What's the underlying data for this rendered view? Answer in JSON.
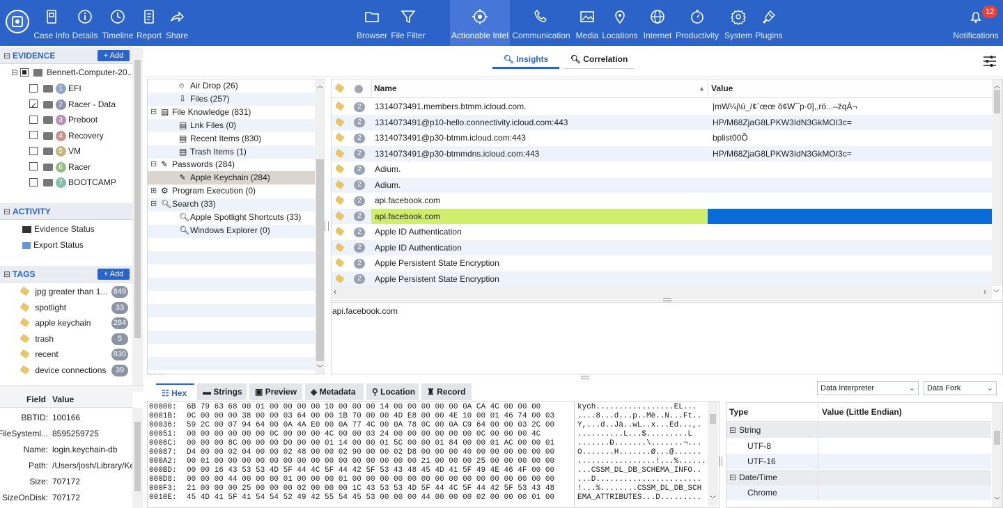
{
  "toolbar": {
    "left": [
      {
        "label": "Case Info",
        "icon": "case-info-icon"
      },
      {
        "label": "Details",
        "icon": "details-icon"
      },
      {
        "label": "Timeline",
        "icon": "timeline-icon"
      },
      {
        "label": "Report",
        "icon": "report-icon"
      },
      {
        "label": "Share",
        "icon": "share-icon"
      }
    ],
    "center": [
      {
        "label": "Browser",
        "icon": "browser-icon"
      },
      {
        "label": "File Filter",
        "icon": "filter-icon"
      },
      {
        "label": "Actionable Intel",
        "icon": "actionable-intel-icon",
        "active": true
      },
      {
        "label": "Communication",
        "icon": "phone-icon"
      },
      {
        "label": "Media",
        "icon": "media-icon"
      },
      {
        "label": "Locations",
        "icon": "location-pin-icon"
      },
      {
        "label": "Internet",
        "icon": "globe-icon"
      },
      {
        "label": "Productivity",
        "icon": "productivity-icon"
      },
      {
        "label": "System",
        "icon": "gear-icon"
      },
      {
        "label": "Plugins",
        "icon": "plugin-icon"
      }
    ],
    "notifications": {
      "label": "Notifications",
      "count": "12"
    }
  },
  "evidence": {
    "title": "EVIDENCE",
    "add_label": "+ Add",
    "root": "Bennett-Computer-20...",
    "items": [
      {
        "num": "1",
        "label": "EFI",
        "checked": false,
        "color": "#8ea5c8"
      },
      {
        "num": "2",
        "label": "Racer - Data",
        "checked": true,
        "color": "#8f8fb8"
      },
      {
        "num": "3",
        "label": "Preboot",
        "checked": false,
        "color": "#b88fb5"
      },
      {
        "num": "4",
        "label": "Recovery",
        "checked": false,
        "color": "#c7958c"
      },
      {
        "num": "5",
        "label": "VM",
        "checked": false,
        "color": "#c2b77f"
      },
      {
        "num": "6",
        "label": "Racer",
        "checked": false,
        "color": "#92bf86"
      },
      {
        "num": "7",
        "label": "BOOTCAMP",
        "checked": false,
        "color": "#86bfa7"
      }
    ]
  },
  "activity": {
    "title": "ACTIVITY",
    "items": [
      "Evidence Status",
      "Export Status"
    ]
  },
  "tags": {
    "title": "TAGS",
    "add_label": "+ Add",
    "items": [
      {
        "label": "jpg greater than 1...",
        "count": "849"
      },
      {
        "label": "spotlight",
        "count": "33"
      },
      {
        "label": "apple keychain",
        "count": "284"
      },
      {
        "label": "trash",
        "count": "5"
      },
      {
        "label": "recent",
        "count": "830"
      },
      {
        "label": "device connections",
        "count": "39"
      }
    ]
  },
  "props": {
    "headers": [
      "Field",
      "Value"
    ],
    "rows": [
      {
        "field": "BBTID:",
        "value": "100166"
      },
      {
        "field": "FileSysteml...",
        "value": "8595259725"
      },
      {
        "field": "Name:",
        "value": "login.keychain-db"
      },
      {
        "field": "Path:",
        "value": "/Users/josh/Library/Key"
      },
      {
        "field": "Size:",
        "value": "707172"
      },
      {
        "field": "SizeOnDisk:",
        "value": "707172"
      }
    ]
  },
  "view_tabs": [
    "Insights",
    "Correlation"
  ],
  "tree": [
    {
      "label": "Air Drop (26)",
      "level": 2,
      "icon": "airdrop-icon"
    },
    {
      "label": "Files (257)",
      "level": 2,
      "icon": "files-icon"
    },
    {
      "label": "File Knowledge (831)",
      "level": 1,
      "icon": "file-knowledge-icon",
      "exp": "−"
    },
    {
      "label": "Lnk Files (0)",
      "level": 2,
      "icon": "document-icon"
    },
    {
      "label": "Recent Items (830)",
      "level": 2,
      "icon": "document-icon"
    },
    {
      "label": "Trash Items (1)",
      "level": 2,
      "icon": "document-icon"
    },
    {
      "label": "Passwords (284)",
      "level": 1,
      "icon": "password-icon",
      "exp": "−"
    },
    {
      "label": "Apple Keychain (284)",
      "level": 2,
      "icon": "password-icon",
      "selected": true
    },
    {
      "label": "Program Execution (0)",
      "level": 1,
      "icon": "program-icon",
      "exp": "+"
    },
    {
      "label": "Search (33)",
      "level": 1,
      "icon": "search-icon",
      "exp": "−"
    },
    {
      "label": "Apple Spotlight Shortcuts (33)",
      "level": 2,
      "icon": "search-icon"
    },
    {
      "label": "Windows Explorer (0)",
      "level": 2,
      "icon": "search-icon"
    }
  ],
  "grid": {
    "headers": [
      "Name",
      "Value"
    ],
    "rows": [
      {
        "ev": "2",
        "name": "1314073491.members.btmm.icloud.com.",
        "value": "|mW¼j\\ú_/¢`œœ õ¢W¯p·0],,rö...–žqÁ¬"
      },
      {
        "ev": "2",
        "name": "1314073491@p10-hello.connectivity.icloud.com:443",
        "value": "HP/M68ZjaG8LPKW3IdN3GkMOI3c="
      },
      {
        "ev": "2",
        "name": "1314073491@p30-btmm.icloud.com:443",
        "value": "bplist00Õ"
      },
      {
        "ev": "2",
        "name": "1314073491@p30-btmmdns.icloud.com:443",
        "value": "HP/M68ZjaG8LPKW3IdN3GkMOI3c="
      },
      {
        "ev": "2",
        "name": "Adium.",
        "value": ""
      },
      {
        "ev": "2",
        "name": "Adium.",
        "value": ""
      },
      {
        "ev": "2",
        "name": "api.facebook.com",
        "value": ""
      },
      {
        "ev": "2",
        "name": "api.facebook.com",
        "value": "",
        "selected": true
      },
      {
        "ev": "2",
        "name": "Apple ID Authentication",
        "value": ""
      },
      {
        "ev": "2",
        "name": "Apple ID Authentication",
        "value": ""
      },
      {
        "ev": "2",
        "name": "Apple Persistent State Encryption",
        "value": ""
      },
      {
        "ev": "2",
        "name": "Apple Persistent State Encryption",
        "value": ""
      }
    ]
  },
  "preview_text": "api.facebook.com",
  "bottom_tabs": [
    "Hex",
    "Strings",
    "Preview",
    "Metadata",
    "Location",
    "Record"
  ],
  "hex": [
    {
      "off": "00000:",
      "bytes": "6B 79 63 68 00 01 00 00 00 00 10 00 00 00 14 00 00 00 00 00 0A CA 4C 00 00 00",
      "ascii": "kych.................ÊL..."
    },
    {
      "off": "0001B:",
      "bytes": "0C 00 00 00 38 00 00 03 64 00 00 1B 70 00 00 4D E8 00 00 4E 10 00 01 46 74 00 03",
      "ascii": "....8...d...p..Mè..N...Ft.."
    },
    {
      "off": "00036:",
      "bytes": "59 2C 00 07 94 64 00 0A 4A E0 00 0A 77 4C 00 0A 78 0C 00 0A C9 64 00 00 03 2C 00",
      "ascii": "Y,...d..Jà..wL..x...Éd...,."
    },
    {
      "off": "00051:",
      "bytes": "00 00 00 00 00 00 0C 00 00 00 4C 00 00 03 24 00 00 00 00 00 00 0C 00 00 00 4C",
      "ascii": "..........L...$.........L"
    },
    {
      "off": "0006C:",
      "bytes": "00 00 00 8C 00 00 00 D0 00 00 01 14 00 00 01 5C 00 00 01 84 00 00 01 AC 00 00 01",
      "ascii": ".......Ð.......\\.......¬..."
    },
    {
      "off": "00087:",
      "bytes": "D4 00 00 02 04 00 00 02 48 00 00 02 90 00 00 02 D8 00 00 00 40 00 00 00 00 00 00",
      "ascii": "Ô.......H.......Ø...@......"
    },
    {
      "off": "000A2:",
      "bytes": "00 01 00 00 00 00 00 00 00 00 00 00 00 00 00 00 00 21 00 00 00 25 00 00 00 00 00",
      "ascii": ".................!...%......"
    },
    {
      "off": "000BD:",
      "bytes": "00 00 16 43 53 53 4D 5F 44 4C 5F 44 42 5F 53 43 48 45 4D 41 5F 49 4E 46 4F 00 00",
      "ascii": "...CSSM_DL_DB_SCHEMA_INFO.."
    },
    {
      "off": "000D8:",
      "bytes": "00 00 00 44 00 00 00 01 00 00 00 01 00 00 00 00 00 00 00 00 00 00 00 00 00 00 00",
      "ascii": "...D......................."
    },
    {
      "off": "000F3:",
      "bytes": "21 00 00 00 25 00 00 00 02 00 00 00 1C 43 53 53 4D 5F 44 4C 5F 44 42 5F 53 43 48",
      "ascii": "!...%........CSSM_DL_DB_SCH"
    },
    {
      "off": "0010E:",
      "bytes": "45 4D 41 5F 41 54 54 52 49 42 55 54 45 53 00 00 00 44 00 00 00 02 00 00 00 01 00",
      "ascii": "EMA_ATTRIBUTES...D........."
    }
  ],
  "interpreter": {
    "dropdown1": "Data Interpreter",
    "dropdown2": "Data Fork",
    "headers": [
      "Type",
      "Value (Little Endian)"
    ],
    "rows": [
      {
        "label": "String",
        "group": true
      },
      {
        "label": "UTF-8",
        "group": false
      },
      {
        "label": "UTF-16",
        "group": false
      },
      {
        "label": "Date/Time",
        "group": true
      },
      {
        "label": "Chrome",
        "group": false
      }
    ]
  },
  "colors": {
    "accent": "#2b63c9",
    "selected_row": "#cfee6e",
    "selected_value": "#0a6ad6"
  }
}
